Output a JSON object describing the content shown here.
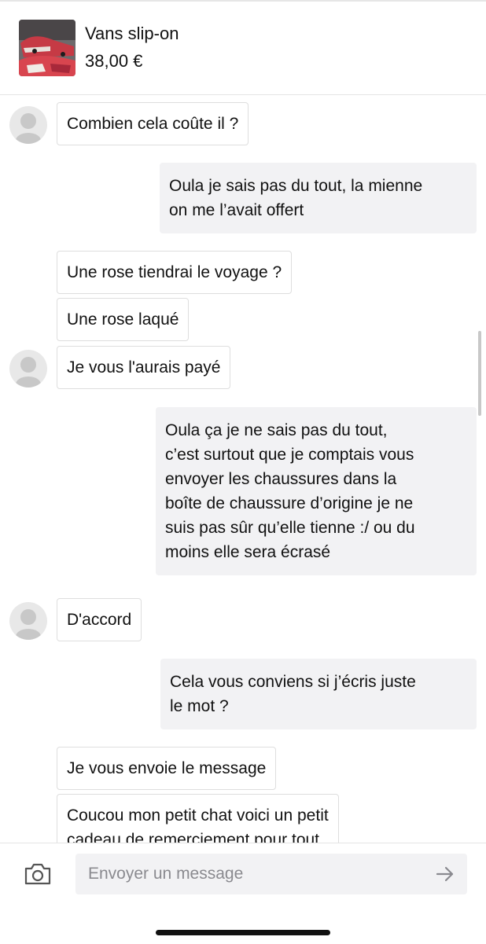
{
  "header": {
    "product_title": "Vans slip-on",
    "product_price": "38,00 €",
    "thumbnail": "red-sneakers-photo"
  },
  "messages": [
    {
      "side": "in",
      "text": "Combien cela coûte il ?"
    },
    {
      "side": "out",
      "text": "Oula je sais pas du tout, la mienne\non me l’avait offert"
    },
    {
      "side": "in",
      "text": "Une rose tiendrai le voyage ?"
    },
    {
      "side": "in",
      "text": "Une rose laqué"
    },
    {
      "side": "in",
      "text": "Je vous l'aurais payé"
    },
    {
      "side": "out",
      "text": "Oula ça je ne sais pas du tout,\nc’est surtout que je comptais vous\nenvoyer les chaussures dans la\nboîte de chaussure d’origine je ne\nsuis pas sûr qu’elle tienne :/ ou du\nmoins elle sera écrasé"
    },
    {
      "side": "in",
      "text": "D'accord"
    },
    {
      "side": "out",
      "text": "Cela vous conviens si j’écris juste\nle mot ?"
    },
    {
      "side": "in",
      "text": "Je vous envoie le message"
    },
    {
      "side": "in",
      "text": "Coucou mon petit chat voici un petit\ncadeau de remerciement pour tout"
    }
  ],
  "composer": {
    "placeholder": "Envoyer un message",
    "camera_icon": "camera-icon",
    "send_icon": "arrow-right-icon"
  },
  "colors": {
    "outgoing_bubble": "#f2f2f4",
    "incoming_border": "#dedede",
    "avatar": "#e8e8e8"
  }
}
